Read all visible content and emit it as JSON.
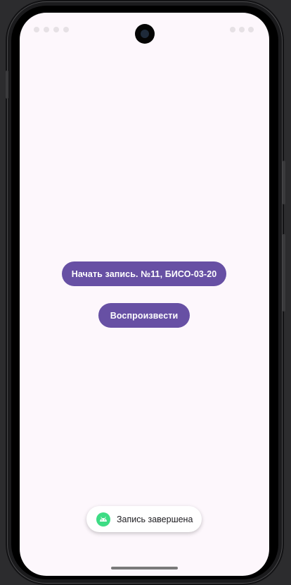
{
  "app": {
    "record_button_label": "Начать запись. №11, БИСО-03-20",
    "play_button_label": "Воспроизвести",
    "toast_message": "Запись завершена",
    "toast_icon": "android-icon"
  },
  "theme": {
    "background": "#fdf7fc",
    "accent": "#6750a4",
    "on_accent": "#ffffff",
    "toast_icon_color": "#3ddc84"
  }
}
